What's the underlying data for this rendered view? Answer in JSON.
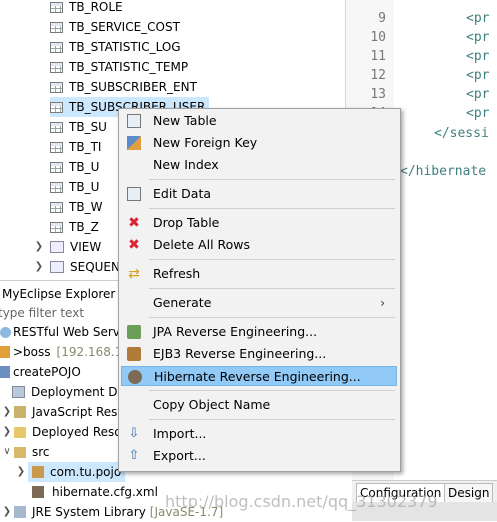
{
  "db_tree": {
    "tables": [
      "TB_ROLE",
      "TB_SERVICE_COST",
      "TB_STATISTIC_LOG",
      "TB_STATISTIC_TEMP",
      "TB_SUBSCRIBER_ENT",
      "TB_SUBSCRIBER_USER",
      "TB_SU",
      "TB_TI",
      "TB_U",
      "TB_U",
      "TB_W",
      "TB_Z"
    ],
    "view_label": "VIEW",
    "sequence_label": "SEQUEN"
  },
  "editor": {
    "line_numbers": [
      "9",
      "10",
      "11",
      "12",
      "13",
      "14"
    ],
    "lines": [
      "<pr",
      "<pr",
      "<pr",
      "<pr",
      "<pr",
      "<pr"
    ],
    "close_session": "</sessi",
    "close_hibernate": "</hibernate"
  },
  "explorer": {
    "title": "MyEclipse Explorer",
    "filter_placeholder": "type filter text",
    "items": [
      {
        "label": "RESTful Web Servi"
      },
      {
        "label": ">boss",
        "detail": "[192.168.1"
      },
      {
        "label": "createPOJO"
      },
      {
        "label": "Deployment De"
      },
      {
        "label": "JavaScript Reso"
      },
      {
        "label": "Deployed Reso"
      },
      {
        "label": "src"
      },
      {
        "label": "com.tu.pojo"
      },
      {
        "label": "hibernate.cfg.xml"
      },
      {
        "label": "JRE System Library",
        "detail": "[JavaSE-1.7]"
      }
    ]
  },
  "bottom_tabs": [
    "Configuration",
    "Design"
  ],
  "watermark": "http://blog.csdn.net/qq_31302379",
  "context_menu": {
    "items": [
      {
        "label": "New Table",
        "icon": "table-icon"
      },
      {
        "label": "New Foreign Key",
        "icon": "foreign-key-icon"
      },
      {
        "label": "New Index",
        "icon": "index-icon"
      },
      {
        "label": "Edit Data",
        "icon": "table-icon"
      },
      {
        "label": "Drop Table",
        "icon": "delete-icon"
      },
      {
        "label": "Delete All Rows",
        "icon": "delete-icon"
      },
      {
        "label": "Refresh",
        "icon": "refresh-icon"
      },
      {
        "label": "Generate",
        "icon": ""
      },
      {
        "label": "JPA Reverse Engineering...",
        "icon": "jpa-icon"
      },
      {
        "label": "EJB3 Reverse Engineering...",
        "icon": "ejb3-icon"
      },
      {
        "label": "Hibernate Reverse Engineering...",
        "icon": "hibernate-icon"
      },
      {
        "label": "Copy Object Name",
        "icon": ""
      },
      {
        "label": "Import...",
        "icon": "import-icon"
      },
      {
        "label": "Export...",
        "icon": "export-icon"
      }
    ]
  }
}
